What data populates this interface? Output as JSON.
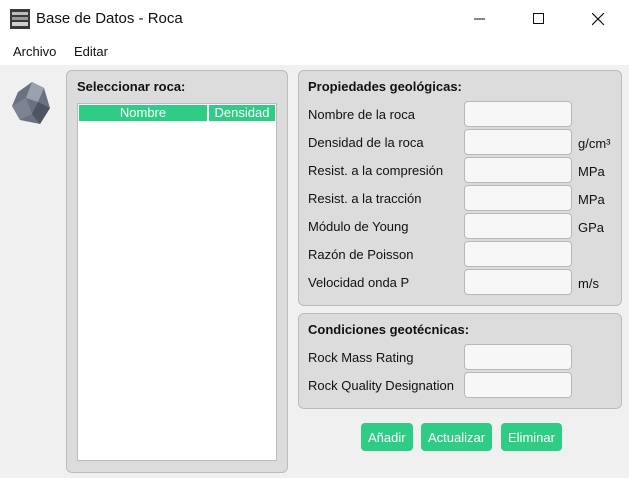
{
  "window": {
    "title": "Base de Datos - Roca",
    "icon": "database-app-icon",
    "controls": [
      "minimize-icon",
      "maximize-icon",
      "close-icon"
    ]
  },
  "menu": {
    "items": [
      "Archivo",
      "Editar"
    ]
  },
  "left_panel": {
    "title": "Seleccionar roca:",
    "columns": [
      "Nombre",
      "Densidad"
    ],
    "rows": []
  },
  "geo_props": {
    "title": "Propiedades geológicas:",
    "fields": [
      {
        "label": "Nombre de la roca",
        "value": "",
        "unit": ""
      },
      {
        "label": "Densidad de la roca",
        "value": "",
        "unit": "g/cm³"
      },
      {
        "label": "Resist. a la compresión",
        "value": "",
        "unit": "MPa"
      },
      {
        "label": "Resist. a la tracción",
        "value": "",
        "unit": "MPa"
      },
      {
        "label": "Módulo de Young",
        "value": "",
        "unit": "GPa"
      },
      {
        "label": "Razón de Poisson",
        "value": "",
        "unit": ""
      },
      {
        "label": "Velocidad onda P",
        "value": "",
        "unit": "m/s"
      }
    ]
  },
  "geotech": {
    "title": "Condiciones geotécnicas:",
    "fields": [
      {
        "label": "Rock Mass Rating",
        "value": ""
      },
      {
        "label": "Rock Quality Designation",
        "value": ""
      }
    ]
  },
  "actions": {
    "add": "Añadir",
    "update": "Actualizar",
    "delete": "Eliminar"
  },
  "colors": {
    "accent": "#2ecc85",
    "panel": "#dcdcdc",
    "background": "#f0f0f0"
  }
}
